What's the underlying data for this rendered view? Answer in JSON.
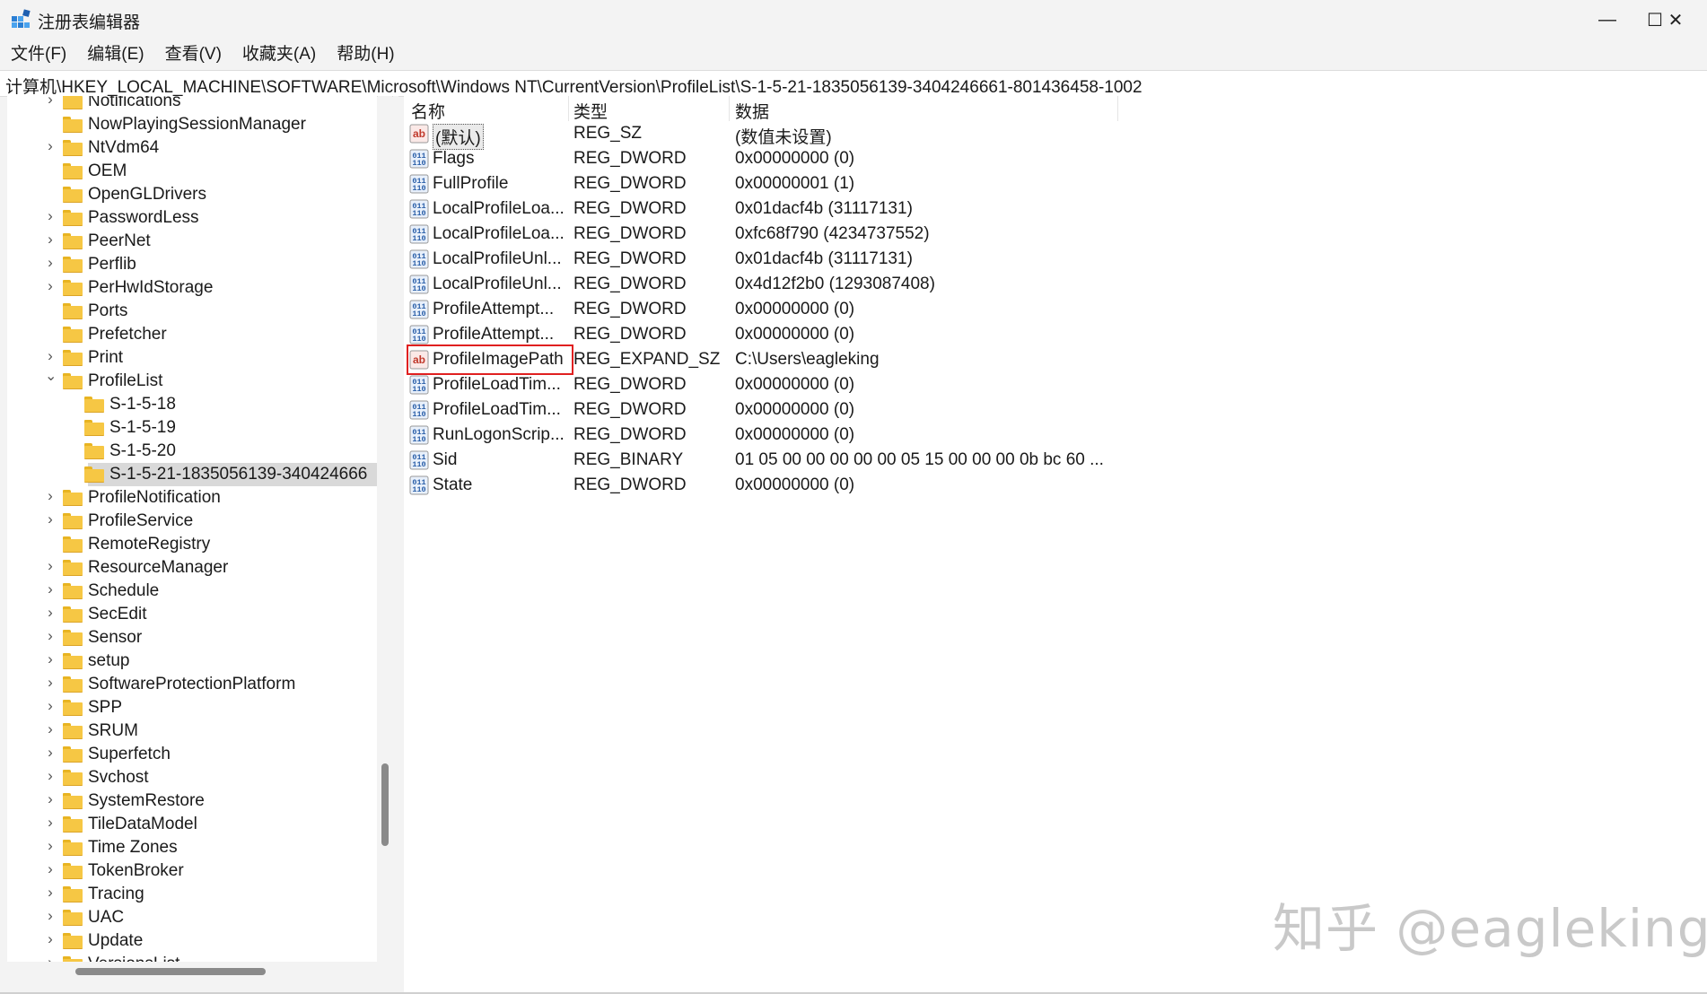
{
  "window": {
    "title": "注册表编辑器",
    "minimize_glyph": "—",
    "maximize_glyph": "☐",
    "close_glyph": "✕"
  },
  "menu": [
    "文件(F)",
    "编辑(E)",
    "查看(V)",
    "收藏夹(A)",
    "帮助(H)"
  ],
  "address": "计算机\\HKEY_LOCAL_MACHINE\\SOFTWARE\\Microsoft\\Windows NT\\CurrentVersion\\ProfileList\\S-1-5-21-1835056139-3404246661-801436458-1002",
  "tree": {
    "items": [
      {
        "label": "Notifications",
        "level": 0,
        "chevron": "right"
      },
      {
        "label": "NowPlayingSessionManager",
        "level": 0,
        "chevron": "none"
      },
      {
        "label": "NtVdm64",
        "level": 0,
        "chevron": "right"
      },
      {
        "label": "OEM",
        "level": 0,
        "chevron": "none"
      },
      {
        "label": "OpenGLDrivers",
        "level": 0,
        "chevron": "none"
      },
      {
        "label": "PasswordLess",
        "level": 0,
        "chevron": "right"
      },
      {
        "label": "PeerNet",
        "level": 0,
        "chevron": "right"
      },
      {
        "label": "Perflib",
        "level": 0,
        "chevron": "right"
      },
      {
        "label": "PerHwIdStorage",
        "level": 0,
        "chevron": "right"
      },
      {
        "label": "Ports",
        "level": 0,
        "chevron": "none"
      },
      {
        "label": "Prefetcher",
        "level": 0,
        "chevron": "none"
      },
      {
        "label": "Print",
        "level": 0,
        "chevron": "right"
      },
      {
        "label": "ProfileList",
        "level": 0,
        "chevron": "down"
      },
      {
        "label": "S-1-5-18",
        "level": 1,
        "chevron": "none"
      },
      {
        "label": "S-1-5-19",
        "level": 1,
        "chevron": "none"
      },
      {
        "label": "S-1-5-20",
        "level": 1,
        "chevron": "none"
      },
      {
        "label": "S-1-5-21-1835056139-340424666",
        "level": 1,
        "chevron": "none",
        "selected": true
      },
      {
        "label": "ProfileNotification",
        "level": 0,
        "chevron": "right"
      },
      {
        "label": "ProfileService",
        "level": 0,
        "chevron": "right"
      },
      {
        "label": "RemoteRegistry",
        "level": 0,
        "chevron": "none"
      },
      {
        "label": "ResourceManager",
        "level": 0,
        "chevron": "right"
      },
      {
        "label": "Schedule",
        "level": 0,
        "chevron": "right"
      },
      {
        "label": "SecEdit",
        "level": 0,
        "chevron": "right"
      },
      {
        "label": "Sensor",
        "level": 0,
        "chevron": "right"
      },
      {
        "label": "setup",
        "level": 0,
        "chevron": "right"
      },
      {
        "label": "SoftwareProtectionPlatform",
        "level": 0,
        "chevron": "right"
      },
      {
        "label": "SPP",
        "level": 0,
        "chevron": "right"
      },
      {
        "label": "SRUM",
        "level": 0,
        "chevron": "right"
      },
      {
        "label": "Superfetch",
        "level": 0,
        "chevron": "right"
      },
      {
        "label": "Svchost",
        "level": 0,
        "chevron": "right"
      },
      {
        "label": "SystemRestore",
        "level": 0,
        "chevron": "right"
      },
      {
        "label": "TileDataModel",
        "level": 0,
        "chevron": "right"
      },
      {
        "label": "Time Zones",
        "level": 0,
        "chevron": "right"
      },
      {
        "label": "TokenBroker",
        "level": 0,
        "chevron": "right"
      },
      {
        "label": "Tracing",
        "level": 0,
        "chevron": "right"
      },
      {
        "label": "UAC",
        "level": 0,
        "chevron": "right"
      },
      {
        "label": "Update",
        "level": 0,
        "chevron": "right"
      },
      {
        "label": "VersionsList",
        "level": 0,
        "chevron": "right"
      }
    ]
  },
  "list": {
    "columns": [
      "名称",
      "类型",
      "数据"
    ],
    "rows": [
      {
        "icon": "string-value-icon",
        "name": "(默认)",
        "type": "REG_SZ",
        "data": "(数值未设置)",
        "default": true
      },
      {
        "icon": "dword-value-icon",
        "name": "Flags",
        "type": "REG_DWORD",
        "data": "0x00000000 (0)"
      },
      {
        "icon": "dword-value-icon",
        "name": "FullProfile",
        "type": "REG_DWORD",
        "data": "0x00000001 (1)"
      },
      {
        "icon": "dword-value-icon",
        "name": "LocalProfileLoa...",
        "type": "REG_DWORD",
        "data": "0x01dacf4b (31117131)"
      },
      {
        "icon": "dword-value-icon",
        "name": "LocalProfileLoa...",
        "type": "REG_DWORD",
        "data": "0xfc68f790 (4234737552)"
      },
      {
        "icon": "dword-value-icon",
        "name": "LocalProfileUnl...",
        "type": "REG_DWORD",
        "data": "0x01dacf4b (31117131)"
      },
      {
        "icon": "dword-value-icon",
        "name": "LocalProfileUnl...",
        "type": "REG_DWORD",
        "data": "0x4d12f2b0 (1293087408)"
      },
      {
        "icon": "dword-value-icon",
        "name": "ProfileAttempt...",
        "type": "REG_DWORD",
        "data": "0x00000000 (0)"
      },
      {
        "icon": "dword-value-icon",
        "name": "ProfileAttempt...",
        "type": "REG_DWORD",
        "data": "0x00000000 (0)"
      },
      {
        "icon": "string-value-icon",
        "name": "ProfileImagePath",
        "type": "REG_EXPAND_SZ",
        "data": "C:\\Users\\eagleking",
        "highlighted": true
      },
      {
        "icon": "dword-value-icon",
        "name": "ProfileLoadTim...",
        "type": "REG_DWORD",
        "data": "0x00000000 (0)"
      },
      {
        "icon": "dword-value-icon",
        "name": "ProfileLoadTim...",
        "type": "REG_DWORD",
        "data": "0x00000000 (0)"
      },
      {
        "icon": "dword-value-icon",
        "name": "RunLogonScrip...",
        "type": "REG_DWORD",
        "data": "0x00000000 (0)"
      },
      {
        "icon": "binary-value-icon",
        "name": "Sid",
        "type": "REG_BINARY",
        "data": "01 05 00 00 00 00 00 05 15 00 00 00 0b bc 60 ..."
      },
      {
        "icon": "dword-value-icon",
        "name": "State",
        "type": "REG_DWORD",
        "data": "0x00000000 (0)"
      }
    ]
  },
  "watermark": "知乎 @eagleking",
  "colors": {
    "folder": "#f6c744",
    "selection": "#d9d9d9",
    "highlight_border": "#e02020",
    "string_icon_red": "#c0392b",
    "dword_icon_blue": "#2a5fa8"
  }
}
